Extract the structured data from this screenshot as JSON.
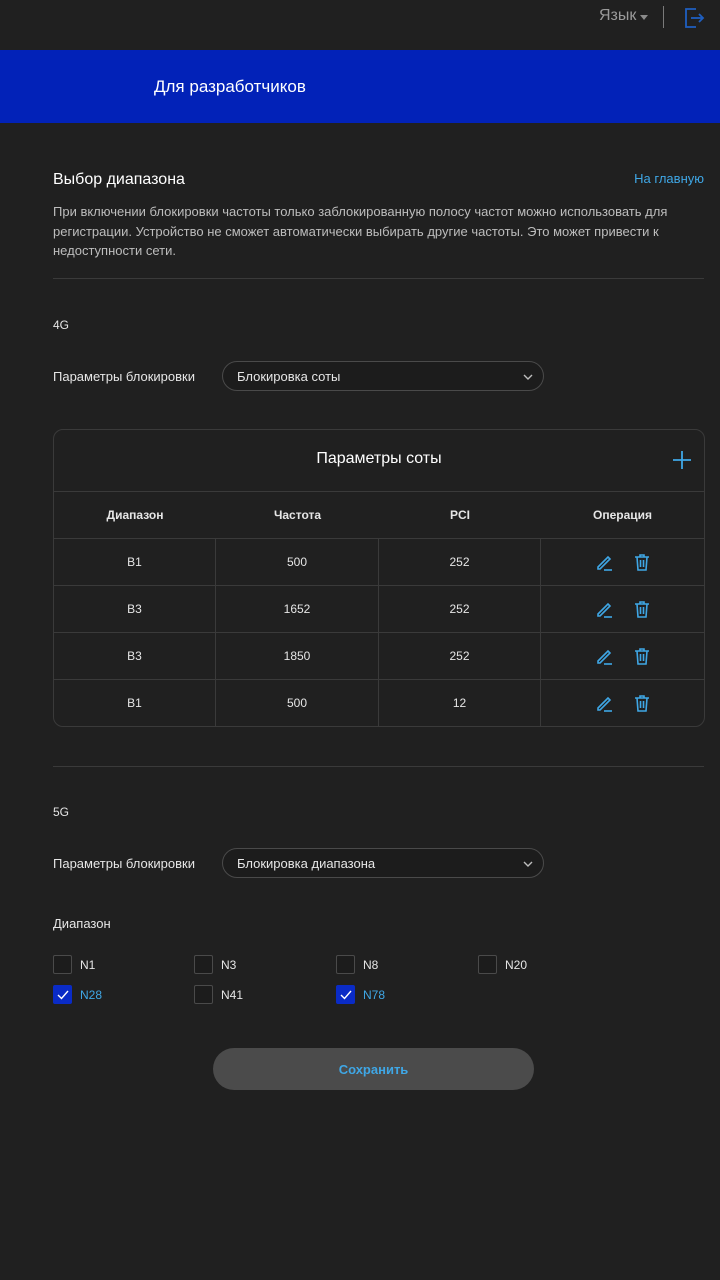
{
  "topbar": {
    "language_label": "Язык"
  },
  "banner": {
    "title": "Для разработчиков"
  },
  "section": {
    "title": "Выбор диапазона",
    "home_link": "На главную",
    "description": "При включении блокировки частоты только заблокированную полосу частот можно использовать для регистрации. Устройство не сможет автоматически выбирать другие частоты. Это может привести к недоступности сети."
  },
  "lte": {
    "label": "4G",
    "lock_label": "Параметры блокировки",
    "lock_value": "Блокировка соты",
    "card_title": "Параметры соты",
    "columns": [
      "Диапазон",
      "Частота",
      "PCI",
      "Операция"
    ],
    "rows": [
      {
        "band": "B1",
        "freq": "500",
        "pci": "252"
      },
      {
        "band": "B3",
        "freq": "1652",
        "pci": "252"
      },
      {
        "band": "B3",
        "freq": "1850",
        "pci": "252"
      },
      {
        "band": "B1",
        "freq": "500",
        "pci": "12"
      }
    ]
  },
  "nr": {
    "label": "5G",
    "lock_label": "Параметры блокировки",
    "lock_value": "Блокировка диапазона",
    "bands_label": "Диапазон",
    "bands": [
      {
        "name": "N1",
        "checked": false
      },
      {
        "name": "N3",
        "checked": false
      },
      {
        "name": "N8",
        "checked": false
      },
      {
        "name": "N20",
        "checked": false
      },
      {
        "name": "N28",
        "checked": true
      },
      {
        "name": "N41",
        "checked": false
      },
      {
        "name": "N78",
        "checked": true
      }
    ]
  },
  "save_label": "Сохранить",
  "colors": {
    "accent": "#3fa7e6",
    "banner": "#0222b8",
    "background": "#202020"
  }
}
